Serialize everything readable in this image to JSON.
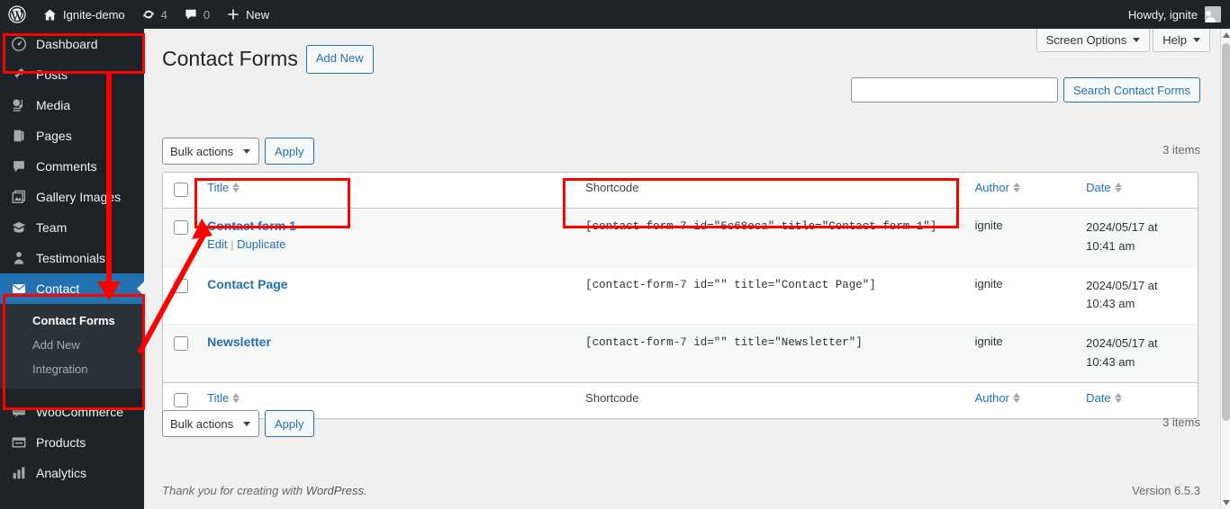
{
  "adminbar": {
    "logo_icon": "wordpress-logo-icon",
    "site_name": "Ignite-demo",
    "home_icon": "home-icon",
    "updates_icon": "updates-icon",
    "updates_count": "4",
    "comments_icon": "comment-bubble-icon",
    "comments_count": "0",
    "new_icon": "plus-icon",
    "new_label": "New",
    "howdy": "Howdy, ignite",
    "avatar_icon": "user-avatar-icon"
  },
  "sidebar": {
    "items": [
      {
        "label": "Dashboard",
        "icon": "dashboard-icon"
      },
      {
        "label": "Posts",
        "icon": "pin-icon"
      },
      {
        "label": "Media",
        "icon": "media-icon"
      },
      {
        "label": "Pages",
        "icon": "page-icon"
      },
      {
        "label": "Comments",
        "icon": "comment-icon"
      },
      {
        "label": "Gallery Images",
        "icon": "gallery-icon"
      },
      {
        "label": "Team",
        "icon": "team-icon"
      },
      {
        "label": "Testimonials",
        "icon": "testimonials-icon"
      },
      {
        "label": "Contact",
        "icon": "envelope-icon"
      },
      {
        "label": "WooCommerce",
        "icon": "woocommerce-icon"
      },
      {
        "label": "Products",
        "icon": "products-icon"
      },
      {
        "label": "Analytics",
        "icon": "analytics-icon"
      }
    ],
    "submenu": [
      {
        "label": "Contact Forms",
        "current": true
      },
      {
        "label": "Add New",
        "current": false
      },
      {
        "label": "Integration",
        "current": false
      }
    ]
  },
  "screen_meta": {
    "screen_options": "Screen Options",
    "help": "Help"
  },
  "header": {
    "title": "Contact Forms",
    "add_new": "Add New"
  },
  "search": {
    "value": "",
    "placeholder": "",
    "submit_label": "Search Contact Forms"
  },
  "tablenav": {
    "bulk_actions_label": "Bulk actions",
    "apply_label": "Apply",
    "items_count_top": "3 items",
    "items_count_bottom": "3 items"
  },
  "table": {
    "columns": {
      "title": "Title",
      "shortcode": "Shortcode",
      "author": "Author",
      "date": "Date"
    },
    "rows": [
      {
        "title": "Contact form 1",
        "actions": {
          "edit": "Edit",
          "separator": "|",
          "duplicate": "Duplicate"
        },
        "shortcode": "[contact-form-7 id=\"5c68eca\" title=\"Contact form 1\"]",
        "author": "ignite",
        "date": "2024/05/17 at 10:41 am"
      },
      {
        "title": "Contact Page",
        "actions": null,
        "shortcode": "[contact-form-7 id=\"\" title=\"Contact Page\"]",
        "author": "ignite",
        "date": "2024/05/17 at 10:43 am"
      },
      {
        "title": "Newsletter",
        "actions": null,
        "shortcode": "[contact-form-7 id=\"\" title=\"Newsletter\"]",
        "author": "ignite",
        "date": "2024/05/17 at 10:43 am"
      }
    ]
  },
  "footer": {
    "thanks_prefix": "Thank you for creating with ",
    "wordpress_link": "WordPress",
    "thanks_suffix": ".",
    "version": "Version 6.5.3"
  },
  "annotations": {
    "color": "#ff0000",
    "boxes": [
      {
        "name": "dashboard-highlight"
      },
      {
        "name": "contact-menu-highlight"
      },
      {
        "name": "contact-form-title-highlight"
      },
      {
        "name": "shortcode-highlight"
      }
    ],
    "arrows": [
      {
        "name": "sidebar-down-arrow"
      },
      {
        "name": "submenu-to-row-arrow"
      }
    ]
  }
}
